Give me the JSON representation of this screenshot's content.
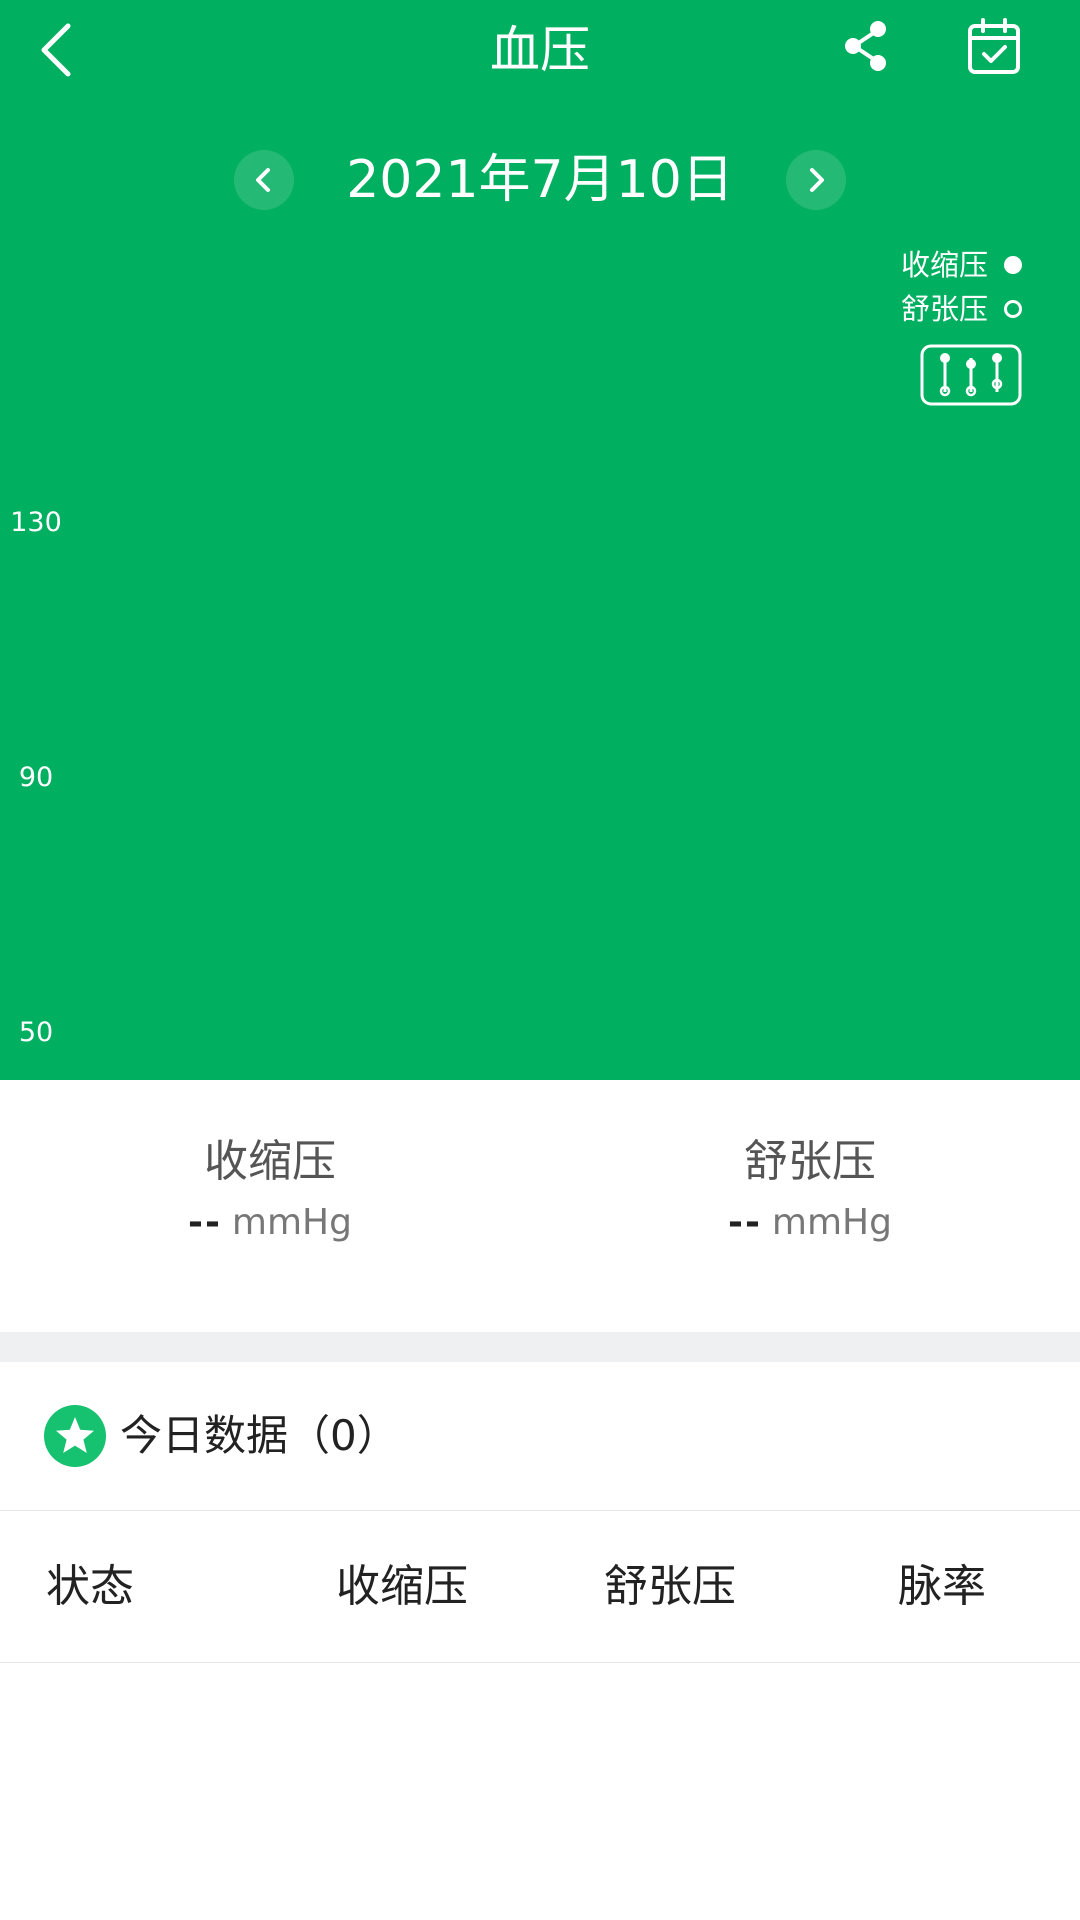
{
  "header": {
    "title": "血压",
    "back_icon": "chevron-left-icon",
    "share_icon": "share-icon",
    "calendar_icon": "calendar-check-icon",
    "background_color": "#00AF5F"
  },
  "date_nav": {
    "date": "2021年7月10日",
    "prev_icon": "chevron-left-icon",
    "next_icon": "chevron-right-icon"
  },
  "legend": {
    "items": [
      {
        "label": "收缩压",
        "marker": "filled-circle"
      },
      {
        "label": "舒张压",
        "marker": "hollow-circle"
      }
    ],
    "toggle_icon": "chart-mode-icon"
  },
  "chart_data": {
    "type": "scatter",
    "y_ticks": [
      "130",
      "90",
      "50"
    ],
    "ylim": [
      50,
      130
    ],
    "series": [
      {
        "name": "收缩压",
        "values": []
      },
      {
        "name": "舒张压",
        "values": []
      }
    ],
    "legend_position": "top-right",
    "grid": false
  },
  "summary": {
    "systolic": {
      "label": "收缩压",
      "value": "--",
      "unit": "mmHg"
    },
    "diastolic": {
      "label": "舒张压",
      "value": "--",
      "unit": "mmHg"
    }
  },
  "today": {
    "icon": "star-icon",
    "label": "今日数据（0）"
  },
  "table": {
    "headers": [
      "状态",
      "收缩压",
      "舒张压",
      "脉率"
    ],
    "rows": []
  }
}
